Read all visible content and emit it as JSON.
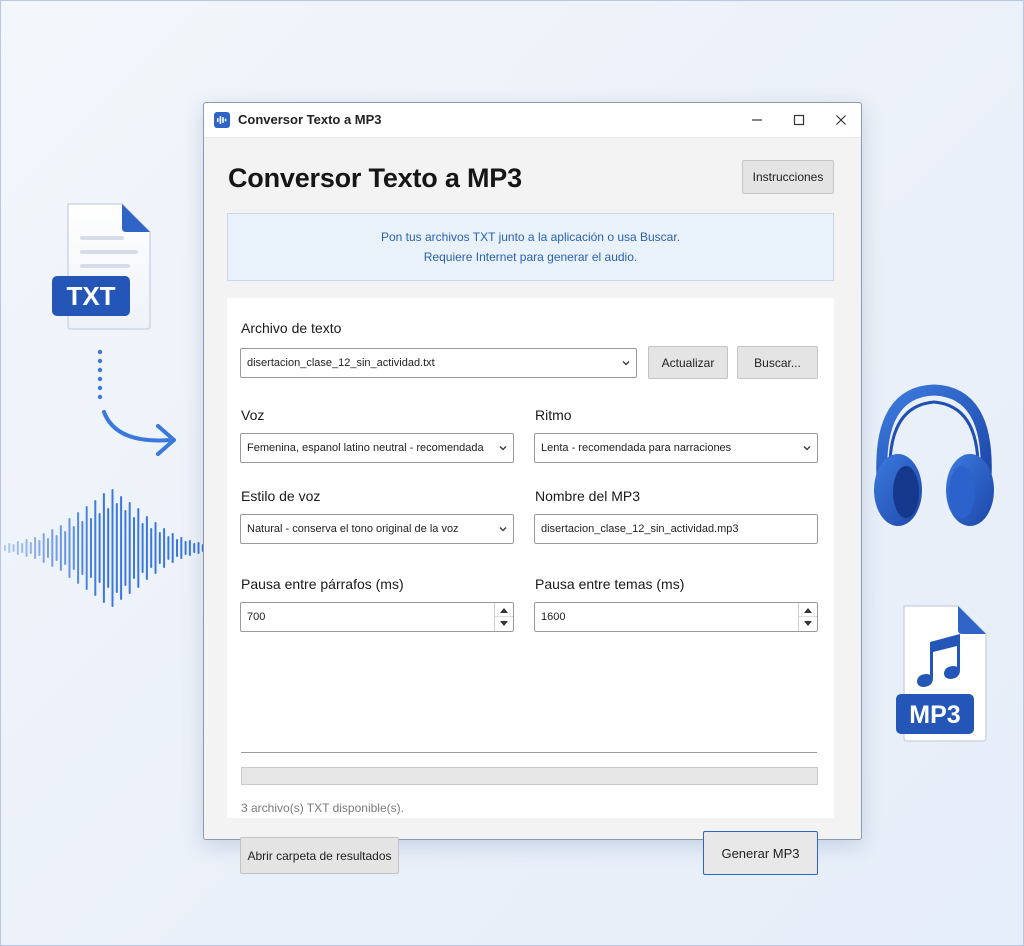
{
  "window": {
    "title": "Conversor Texto a MP3",
    "controls": [
      "minimize",
      "maximize",
      "close"
    ]
  },
  "header": {
    "title": "Conversor Texto a MP3",
    "instructions_label": "Instrucciones"
  },
  "info": {
    "line1": "Pon tus archivos TXT junto a la aplicación o usa Buscar.",
    "line2": "Requiere Internet para generar el audio."
  },
  "form": {
    "file": {
      "label": "Archivo de texto",
      "value": "disertacion_clase_12_sin_actividad.txt",
      "refresh_label": "Actualizar",
      "browse_label": "Buscar..."
    },
    "voice": {
      "label": "Voz",
      "value": "Femenina, espanol latino neutral - recomendada"
    },
    "rhythm": {
      "label": "Ritmo",
      "value": "Lenta - recomendada para narraciones"
    },
    "voice_style": {
      "label": "Estilo de voz",
      "value": "Natural - conserva el tono original de la voz"
    },
    "mp3_name": {
      "label": "Nombre del MP3",
      "value": "disertacion_clase_12_sin_actividad.mp3"
    },
    "paragraph_pause": {
      "label": "Pausa entre párrafos (ms)",
      "value": "700"
    },
    "topic_pause": {
      "label": "Pausa entre temas (ms)",
      "value": "1600"
    }
  },
  "progress": {
    "value": 0
  },
  "status": "3 archivo(s) TXT disponible(s).",
  "actions": {
    "open_folder_label": "Abrir carpeta de resultados",
    "generate_label": "Generar MP3"
  },
  "decorations": {
    "txt_badge": "TXT",
    "mp3_badge": "MP3",
    "icons": [
      "txt-file-icon",
      "dotted-arrow-icon",
      "sound-wave-icon",
      "headphones-icon",
      "mp3-file-icon",
      "music-note-icon"
    ]
  },
  "colors": {
    "accent": "#2f63c6",
    "info_bg": "#e9f1fb",
    "info_text": "#2a62b0",
    "badge_blue": "#2456b8"
  }
}
